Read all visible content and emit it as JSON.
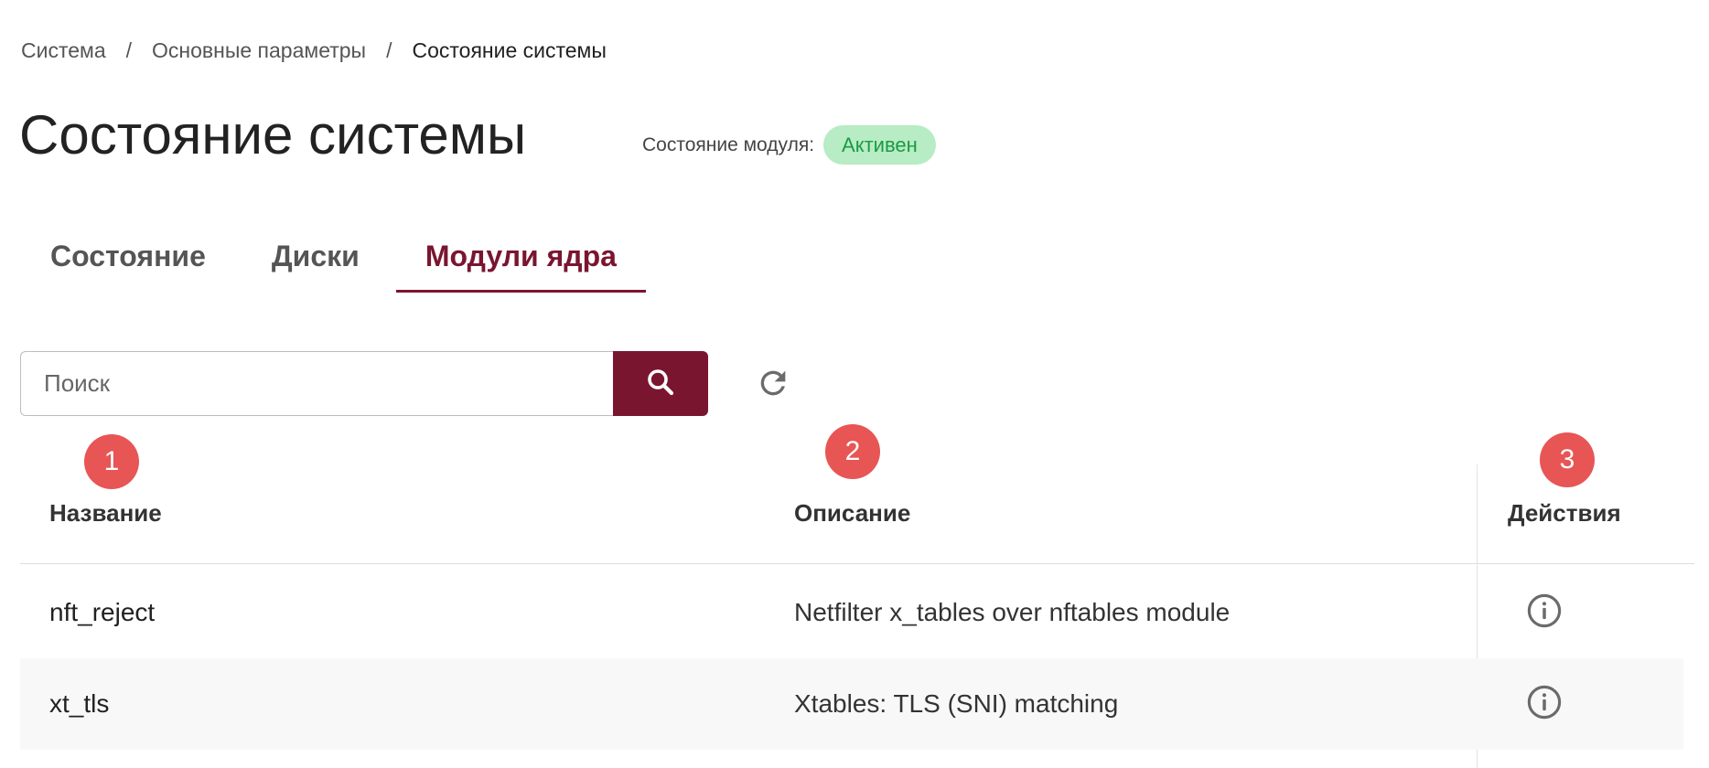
{
  "breadcrumb": {
    "items": [
      "Система",
      "Основные параметры",
      "Состояние системы"
    ],
    "separator": "/"
  },
  "page": {
    "title": "Состояние системы"
  },
  "module_status": {
    "label": "Состояние модуля:",
    "value": "Активен",
    "badge_bg": "#b7ecc4",
    "badge_text_color": "#1c9a45"
  },
  "tabs": [
    {
      "label": "Состояние",
      "active": false
    },
    {
      "label": "Диски",
      "active": false
    },
    {
      "label": "Модули ядра",
      "active": true
    }
  ],
  "search": {
    "placeholder": "Поиск",
    "value": "",
    "button_icon": "search-icon"
  },
  "refresh": {
    "icon": "refresh-icon"
  },
  "markers": [
    "1",
    "2",
    "3"
  ],
  "table": {
    "columns": [
      "Название",
      "Описание",
      "Действия"
    ],
    "rows": [
      {
        "name": "nft_reject",
        "description": "Netfilter x_tables over nftables module",
        "action_icon": "info-icon"
      },
      {
        "name": "xt_tls",
        "description": "Xtables: TLS (SNI) matching",
        "action_icon": "info-icon"
      }
    ]
  },
  "colors": {
    "accent": "#7a1530",
    "marker": "#e85555",
    "row_alt": "#f8f8f8"
  }
}
